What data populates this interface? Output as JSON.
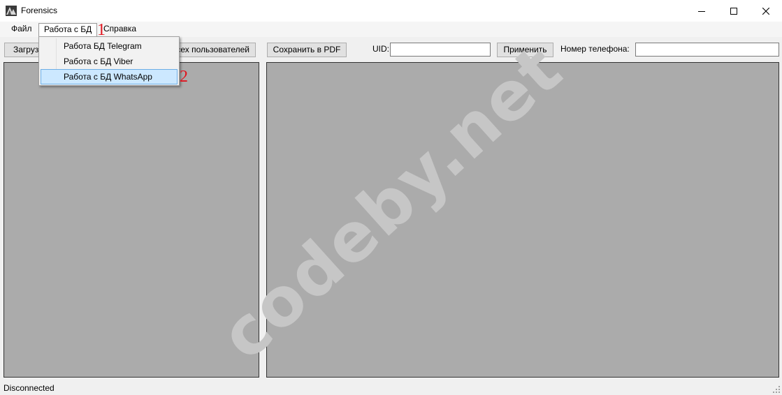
{
  "window": {
    "title": "Forensics",
    "controls": {
      "minimize": "—",
      "maximize": "☐",
      "close": "✕"
    }
  },
  "menubar": {
    "items": [
      {
        "label": "Файл"
      },
      {
        "label": "Работа с БД"
      },
      {
        "label": "Справка"
      }
    ]
  },
  "dropdown": {
    "items": [
      {
        "label": "Работа  БД Telegram"
      },
      {
        "label": "Работа с БД Viber"
      },
      {
        "label": "Работа с БД WhatsApp"
      }
    ],
    "highlighted_index": 2
  },
  "annotations": {
    "step1": "1",
    "step2": "2"
  },
  "toolbar": {
    "load_button": "Загрузить",
    "users_button": "Показать всех пользователей",
    "save_pdf_button": "Сохранить в PDF",
    "uid_label": "UID:",
    "uid_value": "",
    "apply_button": "Применить",
    "phone_label": "Номер телефона:",
    "phone_value": ""
  },
  "status": {
    "text": "Disconnected"
  },
  "watermark": "codeby.net",
  "colors": {
    "panel_bg": "#ababab",
    "annotation": "#e0141e",
    "menu_highlight": "#cce8ff",
    "focus_border": "#0078d7"
  }
}
